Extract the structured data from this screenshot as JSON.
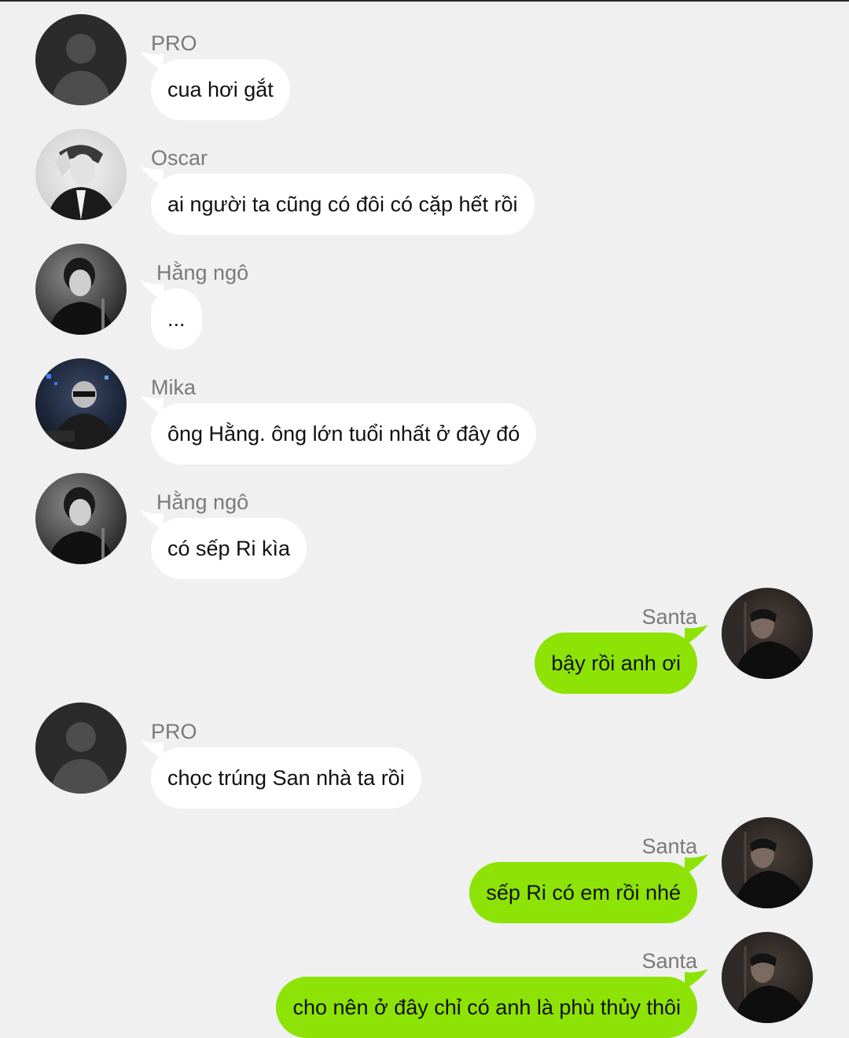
{
  "messages": [
    {
      "sender": "PRO",
      "text": "cua hơi gắt",
      "side": "in",
      "avatar": "default-avatar-icon"
    },
    {
      "sender": "Oscar",
      "text": "ai người ta cũng có đôi có cặp hết rồi",
      "side": "in",
      "avatar": "oscar-avatar"
    },
    {
      "sender": "Hằng ngô",
      "text": "...",
      "side": "in",
      "avatar": "hang-ngo-avatar"
    },
    {
      "sender": "Mika",
      "text": "ông Hằng. ông lớn tuổi nhất ở đây đó",
      "side": "in",
      "avatar": "mika-avatar"
    },
    {
      "sender": "Hằng ngô",
      "text": "có sếp Ri kìa",
      "side": "in",
      "avatar": "hang-ngo-avatar"
    },
    {
      "sender": "Santa",
      "text": "bậy rồi anh ơi",
      "side": "out",
      "avatar": "santa-avatar"
    },
    {
      "sender": "PRO",
      "text": "chọc trúng San nhà ta rồi",
      "side": "in",
      "avatar": "default-avatar-icon"
    },
    {
      "sender": "Santa",
      "text": "sếp Ri có em rồi nhé",
      "side": "out",
      "avatar": "santa-avatar"
    },
    {
      "sender": "Santa",
      "text": "cho nên ở đây chỉ có anh là phù thủy thôi",
      "side": "out",
      "avatar": "santa-avatar"
    }
  ],
  "colors": {
    "background": "#f0f0f0",
    "incoming_bubble": "#ffffff",
    "outgoing_bubble": "#8de305",
    "sender_name": "#7a7a7a"
  }
}
